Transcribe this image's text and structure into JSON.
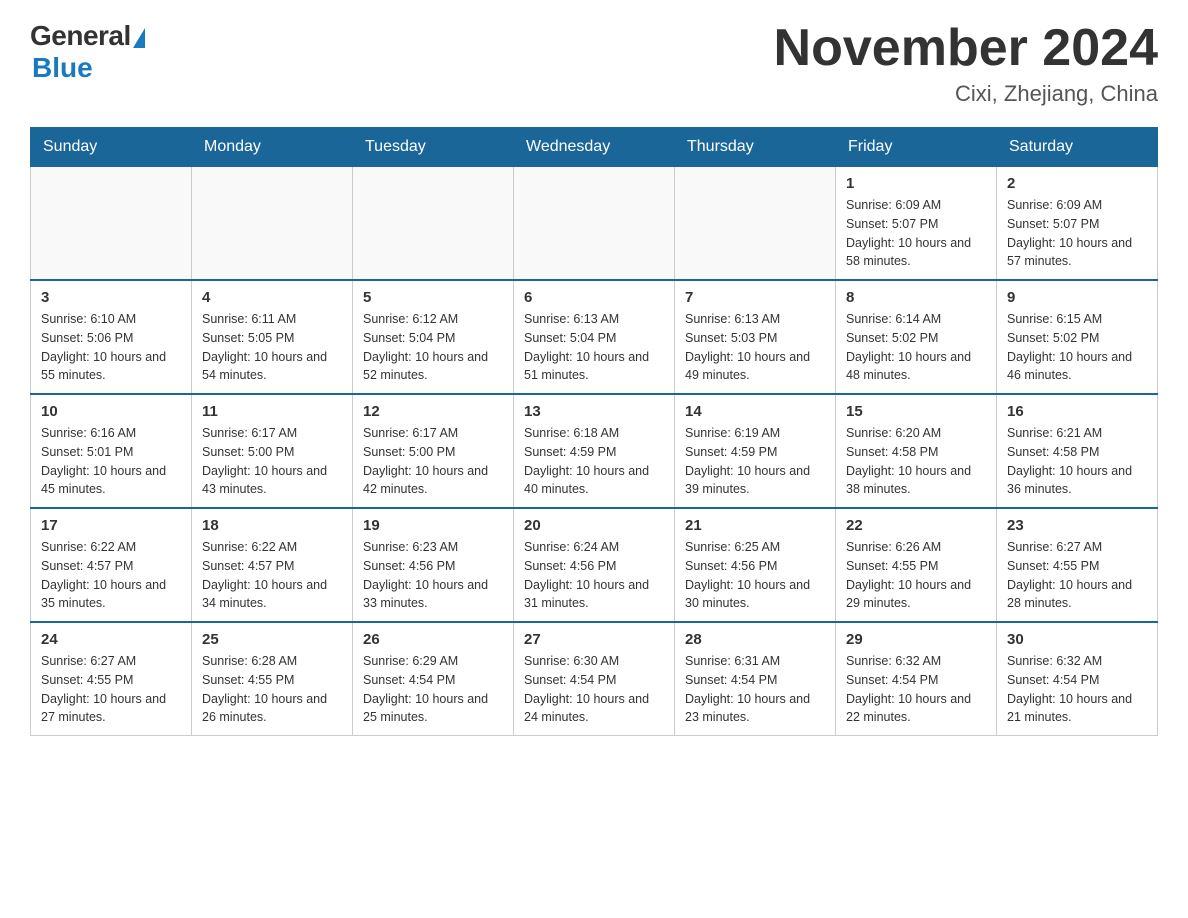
{
  "logo": {
    "general": "General",
    "blue": "Blue"
  },
  "header": {
    "title": "November 2024",
    "subtitle": "Cixi, Zhejiang, China"
  },
  "weekdays": [
    "Sunday",
    "Monday",
    "Tuesday",
    "Wednesday",
    "Thursday",
    "Friday",
    "Saturday"
  ],
  "weeks": [
    [
      {
        "day": "",
        "info": ""
      },
      {
        "day": "",
        "info": ""
      },
      {
        "day": "",
        "info": ""
      },
      {
        "day": "",
        "info": ""
      },
      {
        "day": "",
        "info": ""
      },
      {
        "day": "1",
        "info": "Sunrise: 6:09 AM\nSunset: 5:07 PM\nDaylight: 10 hours and 58 minutes."
      },
      {
        "day": "2",
        "info": "Sunrise: 6:09 AM\nSunset: 5:07 PM\nDaylight: 10 hours and 57 minutes."
      }
    ],
    [
      {
        "day": "3",
        "info": "Sunrise: 6:10 AM\nSunset: 5:06 PM\nDaylight: 10 hours and 55 minutes."
      },
      {
        "day": "4",
        "info": "Sunrise: 6:11 AM\nSunset: 5:05 PM\nDaylight: 10 hours and 54 minutes."
      },
      {
        "day": "5",
        "info": "Sunrise: 6:12 AM\nSunset: 5:04 PM\nDaylight: 10 hours and 52 minutes."
      },
      {
        "day": "6",
        "info": "Sunrise: 6:13 AM\nSunset: 5:04 PM\nDaylight: 10 hours and 51 minutes."
      },
      {
        "day": "7",
        "info": "Sunrise: 6:13 AM\nSunset: 5:03 PM\nDaylight: 10 hours and 49 minutes."
      },
      {
        "day": "8",
        "info": "Sunrise: 6:14 AM\nSunset: 5:02 PM\nDaylight: 10 hours and 48 minutes."
      },
      {
        "day": "9",
        "info": "Sunrise: 6:15 AM\nSunset: 5:02 PM\nDaylight: 10 hours and 46 minutes."
      }
    ],
    [
      {
        "day": "10",
        "info": "Sunrise: 6:16 AM\nSunset: 5:01 PM\nDaylight: 10 hours and 45 minutes."
      },
      {
        "day": "11",
        "info": "Sunrise: 6:17 AM\nSunset: 5:00 PM\nDaylight: 10 hours and 43 minutes."
      },
      {
        "day": "12",
        "info": "Sunrise: 6:17 AM\nSunset: 5:00 PM\nDaylight: 10 hours and 42 minutes."
      },
      {
        "day": "13",
        "info": "Sunrise: 6:18 AM\nSunset: 4:59 PM\nDaylight: 10 hours and 40 minutes."
      },
      {
        "day": "14",
        "info": "Sunrise: 6:19 AM\nSunset: 4:59 PM\nDaylight: 10 hours and 39 minutes."
      },
      {
        "day": "15",
        "info": "Sunrise: 6:20 AM\nSunset: 4:58 PM\nDaylight: 10 hours and 38 minutes."
      },
      {
        "day": "16",
        "info": "Sunrise: 6:21 AM\nSunset: 4:58 PM\nDaylight: 10 hours and 36 minutes."
      }
    ],
    [
      {
        "day": "17",
        "info": "Sunrise: 6:22 AM\nSunset: 4:57 PM\nDaylight: 10 hours and 35 minutes."
      },
      {
        "day": "18",
        "info": "Sunrise: 6:22 AM\nSunset: 4:57 PM\nDaylight: 10 hours and 34 minutes."
      },
      {
        "day": "19",
        "info": "Sunrise: 6:23 AM\nSunset: 4:56 PM\nDaylight: 10 hours and 33 minutes."
      },
      {
        "day": "20",
        "info": "Sunrise: 6:24 AM\nSunset: 4:56 PM\nDaylight: 10 hours and 31 minutes."
      },
      {
        "day": "21",
        "info": "Sunrise: 6:25 AM\nSunset: 4:56 PM\nDaylight: 10 hours and 30 minutes."
      },
      {
        "day": "22",
        "info": "Sunrise: 6:26 AM\nSunset: 4:55 PM\nDaylight: 10 hours and 29 minutes."
      },
      {
        "day": "23",
        "info": "Sunrise: 6:27 AM\nSunset: 4:55 PM\nDaylight: 10 hours and 28 minutes."
      }
    ],
    [
      {
        "day": "24",
        "info": "Sunrise: 6:27 AM\nSunset: 4:55 PM\nDaylight: 10 hours and 27 minutes."
      },
      {
        "day": "25",
        "info": "Sunrise: 6:28 AM\nSunset: 4:55 PM\nDaylight: 10 hours and 26 minutes."
      },
      {
        "day": "26",
        "info": "Sunrise: 6:29 AM\nSunset: 4:54 PM\nDaylight: 10 hours and 25 minutes."
      },
      {
        "day": "27",
        "info": "Sunrise: 6:30 AM\nSunset: 4:54 PM\nDaylight: 10 hours and 24 minutes."
      },
      {
        "day": "28",
        "info": "Sunrise: 6:31 AM\nSunset: 4:54 PM\nDaylight: 10 hours and 23 minutes."
      },
      {
        "day": "29",
        "info": "Sunrise: 6:32 AM\nSunset: 4:54 PM\nDaylight: 10 hours and 22 minutes."
      },
      {
        "day": "30",
        "info": "Sunrise: 6:32 AM\nSunset: 4:54 PM\nDaylight: 10 hours and 21 minutes."
      }
    ]
  ]
}
